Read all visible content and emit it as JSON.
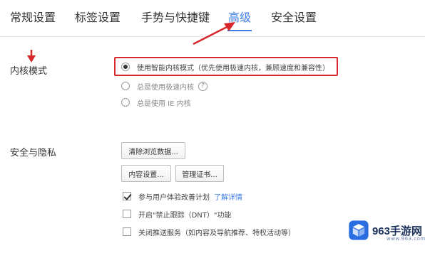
{
  "tabs": [
    {
      "label": "常规设置",
      "active": false
    },
    {
      "label": "标签设置",
      "active": false
    },
    {
      "label": "手势与快捷键",
      "active": false
    },
    {
      "label": "高级",
      "active": true
    },
    {
      "label": "安全设置",
      "active": false
    }
  ],
  "kernel": {
    "label": "内核模式",
    "options": [
      {
        "label": "使用智能内核模式（优先使用极速内核，兼顾速度和兼容性）",
        "selected": true
      },
      {
        "label": "总是使用极速内核",
        "selected": false
      },
      {
        "label": "总是使用 IE 内核",
        "selected": false
      }
    ],
    "help_icon_glyph": "?"
  },
  "privacy": {
    "label": "安全与隐私",
    "clear_button": "清除浏览数据...",
    "content_button": "内容设置...",
    "cert_button": "管理证书...",
    "checks": [
      {
        "label": "参与用户体验改善计划",
        "checked": true,
        "link": "了解详情"
      },
      {
        "label": "开启\"禁止跟踪（DNT）\"功能",
        "checked": false
      },
      {
        "label": "关闭推送服务（如内容及导航推荐、特权活动等）",
        "checked": false
      }
    ]
  },
  "watermark": {
    "text": "963手游网",
    "sub": "www.963.com"
  },
  "colors": {
    "accent": "#3b7de9",
    "highlight": "#d7282e"
  },
  "icons": {
    "annotation_arrow": "red-arrow-icon",
    "logo": "cube-logo-icon"
  }
}
